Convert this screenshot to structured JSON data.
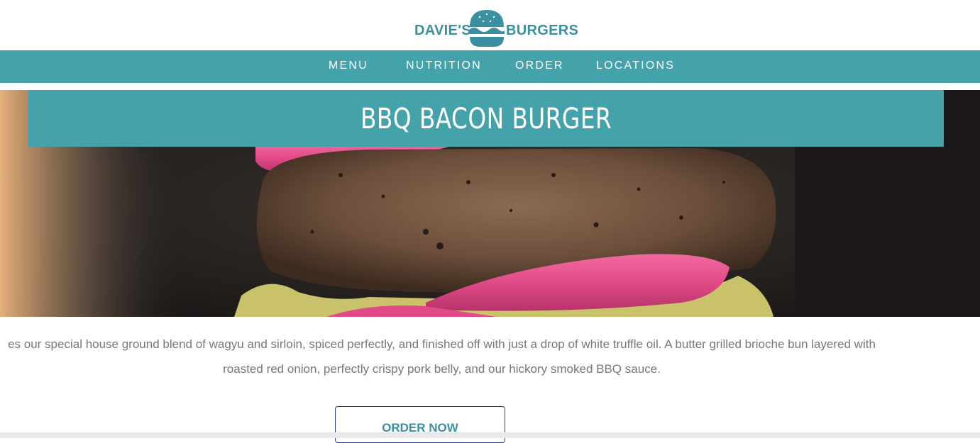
{
  "brand": {
    "name_left": "DAVIE'S",
    "name_right": "BURGERS",
    "logo_icon": "burger-logo-icon",
    "color": "#3a8fa0"
  },
  "nav": {
    "background": "#43a2aa",
    "items": [
      {
        "label": "MENU"
      },
      {
        "label": "NUTRITION"
      },
      {
        "label": "ORDER"
      },
      {
        "label": "LOCATIONS"
      }
    ]
  },
  "hero": {
    "title": "BBQ BACON BURGER",
    "image": "burger-patty-closeup-photo"
  },
  "description": {
    "line1": "es our special house ground blend of wagyu and sirloin, spiced perfectly, and finished off with just a drop of white truffle oil. A butter grilled brioche bun layered with",
    "line2": "roasted red onion, perfectly crispy pork belly, and our hickory smoked BBQ sauce."
  },
  "cta": {
    "label": "ORDER NOW"
  }
}
